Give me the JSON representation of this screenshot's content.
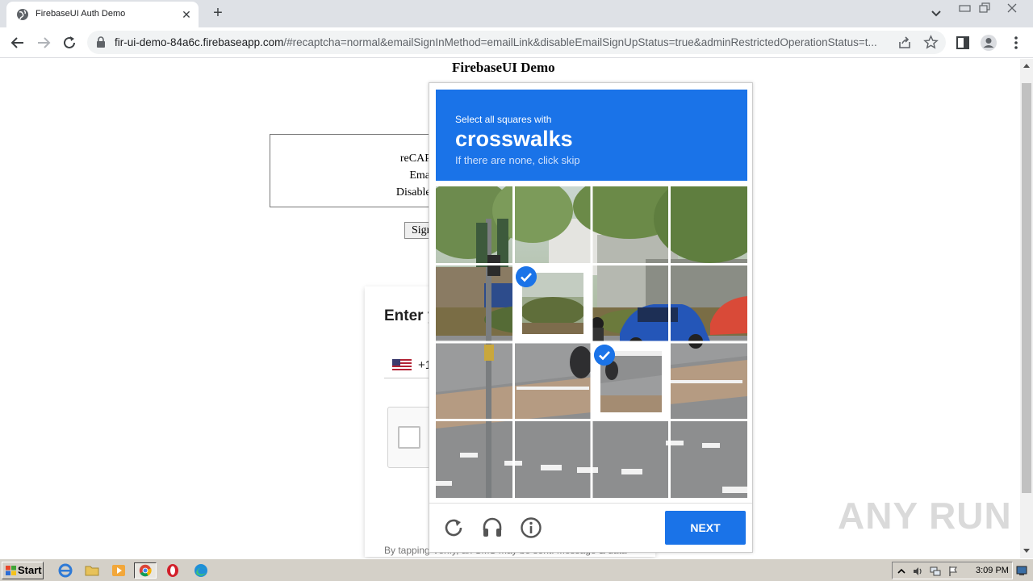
{
  "browser": {
    "tab_title": "FirebaseUI Auth Demo",
    "url_host": "fir-ui-demo-84a6c.firebaseapp.com",
    "url_rest": "/#recaptcha=normal&emailSignInMethod=emailLink&disableEmailSignUpStatus=true&adminRestrictedOperationStatus=t..."
  },
  "page": {
    "title": "FirebaseUI Demo",
    "config_lines": [
      "reCAPTCHA",
      "Email sig",
      "Disable email s"
    ],
    "signin_button": "Sign",
    "card_heading": "Enter y",
    "dial_code": "+1",
    "footer_text": "By tapping Verify, an SMS may be sent. Message & data"
  },
  "captcha": {
    "instruction": "Select all squares with",
    "keyword": "crosswalks",
    "hint": "If there are none, click skip",
    "selected_tiles": [
      5,
      10
    ],
    "next_label": "NEXT",
    "colors": {
      "accent": "#1a73e8"
    }
  },
  "watermark": "ANY RUN",
  "taskbar": {
    "start_label": "Start",
    "clock": "3:09 PM"
  }
}
